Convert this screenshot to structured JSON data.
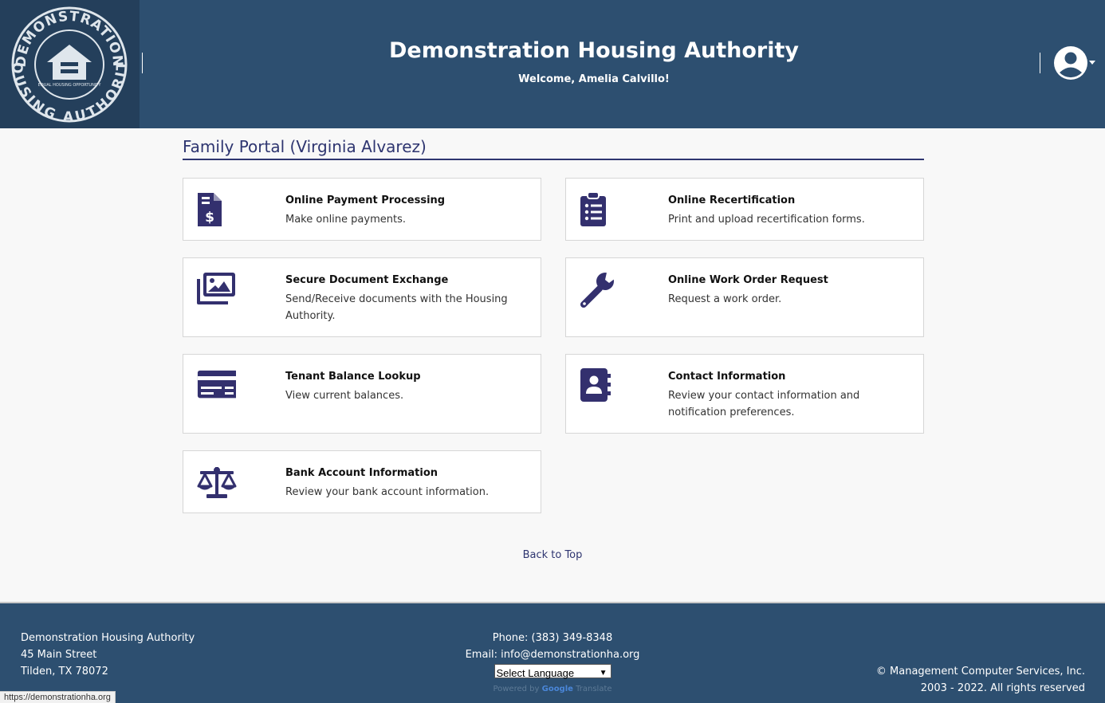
{
  "header": {
    "logo_top_text": "DEMONSTRATION",
    "logo_bottom_text": "HOUSING AUTHORITY",
    "logo_badge_text": "EQUAL HOUSING OPPORTUNITY",
    "title": "Demonstration Housing Authority",
    "welcome": "Welcome, Amelia Calvillo!"
  },
  "portal": {
    "title": "Family Portal (Virginia Alvarez)"
  },
  "cards": [
    {
      "title": "Online Payment Processing",
      "desc": "Make online payments.",
      "icon": "invoice-dollar-icon"
    },
    {
      "title": "Online Recertification",
      "desc": "Print and upload recertification forms.",
      "icon": "clipboard-list-icon"
    },
    {
      "title": "Secure Document Exchange",
      "desc": "Send/Receive documents with the Housing Authority.",
      "icon": "images-icon"
    },
    {
      "title": "Online Work Order Request",
      "desc": "Request a work order.",
      "icon": "wrench-icon"
    },
    {
      "title": "Tenant Balance Lookup",
      "desc": "View current balances.",
      "icon": "credit-card-icon"
    },
    {
      "title": "Contact Information",
      "desc": "Review your contact information and notification preferences.",
      "icon": "address-book-icon"
    },
    {
      "title": "Bank Account Information",
      "desc": "Review your bank account information.",
      "icon": "balance-scale-icon"
    }
  ],
  "back_to_top": "Back to Top",
  "footer": {
    "org": "Demonstration Housing Authority",
    "street": "45 Main Street",
    "city": "Tilden, TX 78072",
    "phone": "Phone: (383) 349-8348",
    "email": "Email: info@demonstrationha.org",
    "language_select": "Select Language",
    "powered_by": "Powered by",
    "google": "Google",
    "translate": "Translate",
    "copyright": "© Management Computer Services, Inc.",
    "rights": "2003 - 2022. All rights reserved"
  },
  "status_bar": {
    "url": "https://demonstrationha.org"
  },
  "colors": {
    "header_bg": "#2d4f70",
    "accent": "#2e3570",
    "icon": "#33306e"
  }
}
